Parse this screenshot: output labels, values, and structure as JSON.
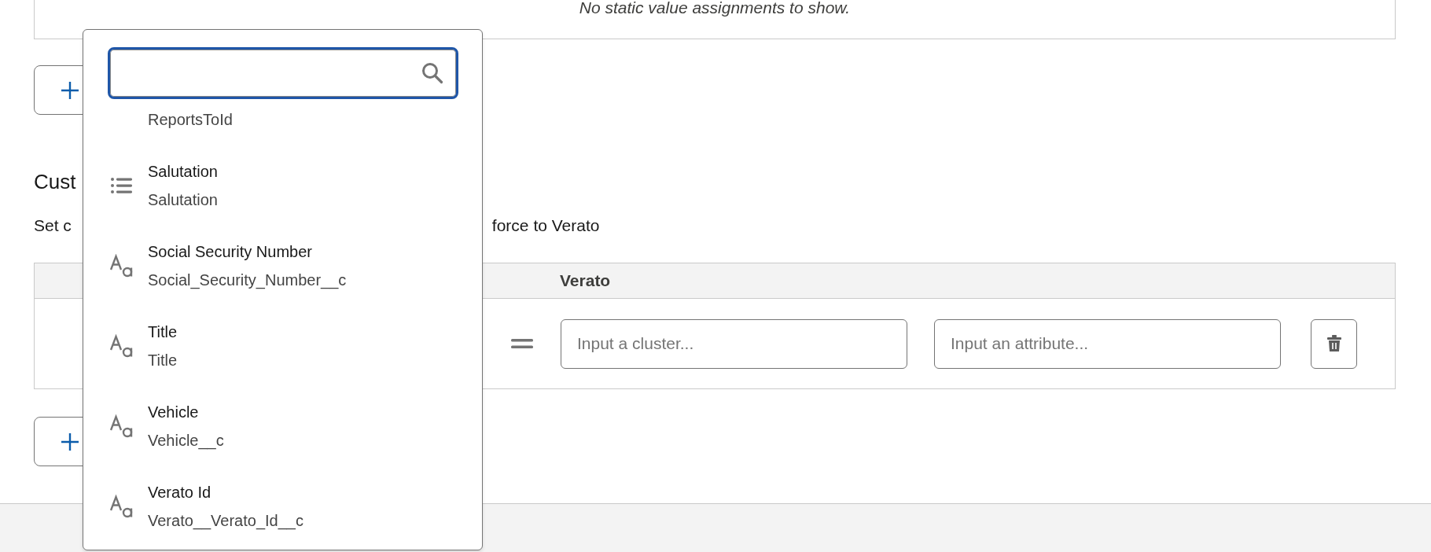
{
  "static_values": {
    "empty_message": "No static value assignments to show."
  },
  "custom_section": {
    "heading": "Cust",
    "description_parts": [
      "Set c",
      "force to Verato"
    ],
    "table": {
      "columns": [
        {
          "header": "Verato"
        }
      ],
      "rows": [
        {
          "cluster_placeholder": "Input a cluster...",
          "attribute_placeholder": "Input an attribute..."
        }
      ]
    }
  },
  "dropdown": {
    "options": [
      {
        "api_name": "ReportsToId"
      },
      {
        "kind": "picklist",
        "label": "Salutation",
        "api_name": "Salutation"
      },
      {
        "kind": "text",
        "label": "Social Security Number",
        "api_name": "Social_Security_Number__c"
      },
      {
        "kind": "text",
        "label": "Title",
        "api_name": "Title"
      },
      {
        "kind": "text",
        "label": "Vehicle",
        "api_name": "Vehicle__c"
      },
      {
        "kind": "text",
        "label": "Verato Id",
        "api_name": "Verato__Verato_Id__c"
      }
    ]
  }
}
